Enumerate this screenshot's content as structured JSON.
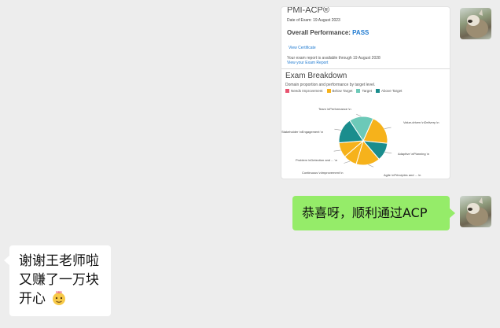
{
  "chat": {
    "card": {
      "title": "PMI-ACP®",
      "date_line": "Date of Exam: 19 August 2023",
      "overall_label": "Overall Performance:",
      "overall_result": "PASS",
      "view_certificate": "View Certificate",
      "report_note": "Your exam report is available through 19 August 2028",
      "view_report": "View your Exam Report",
      "breakdown_title": "Exam Breakdown",
      "breakdown_subtitle": "Domain proportion and performance by target level.",
      "legend": [
        {
          "label": "Needs Improvement",
          "color": "#e8536f"
        },
        {
          "label": "Below Target",
          "color": "#f6b21b"
        },
        {
          "label": "Target",
          "color": "#6cc9b8"
        },
        {
          "label": "Above Target",
          "color": "#1a8d8d"
        }
      ]
    },
    "green_message": "恭喜呀，顺利通过ACP",
    "white_message": {
      "lines": [
        "谢谢王老师啦",
        "又赚了一万块",
        "开心"
      ],
      "emoji": "666-emoji"
    }
  },
  "chart_data": {
    "type": "pie",
    "title": "Exam Breakdown",
    "subtitle": "Domain proportion and performance by target level.",
    "series": [
      {
        "name": "Value-driven \\nDelivery \\n",
        "value": 20,
        "level": "Below Target",
        "color": "#f6b21b"
      },
      {
        "name": "Adaptive \\nPlanning \\n",
        "value": 12,
        "level": "Above Target",
        "color": "#1a8d8d"
      },
      {
        "name": "Agile \\nPrinciples and ... \\n",
        "value": 16,
        "level": "Below Target",
        "color": "#f6b21b"
      },
      {
        "name": "Continuous \\nImprovement \\n",
        "value": 9,
        "level": "Below Target",
        "color": "#f6b21b"
      },
      {
        "name": "Problem \\nDetection and ... \\n",
        "value": 10,
        "level": "Below Target",
        "color": "#f6b21b"
      },
      {
        "name": "Stakeholder \\nEngagement \\n",
        "value": 17,
        "level": "Above Target",
        "color": "#1a8d8d"
      },
      {
        "name": "Team \\nPerformance \\n",
        "value": 16,
        "level": "Target",
        "color": "#6cc9b8"
      }
    ]
  }
}
